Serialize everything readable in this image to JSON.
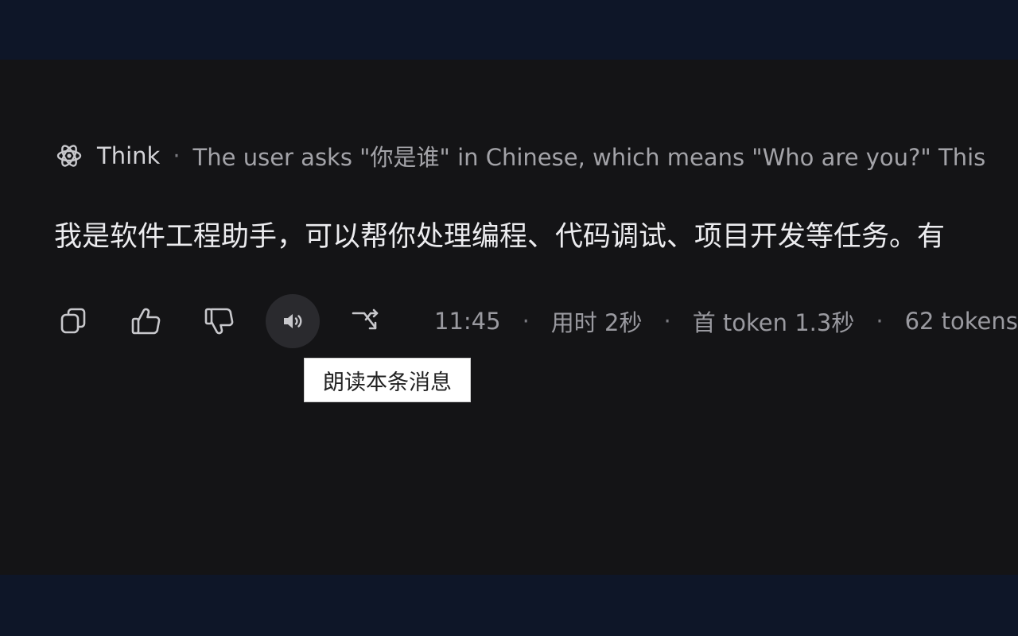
{
  "think": {
    "label": "Think",
    "separator": "·",
    "text": "The user asks \"你是谁\" in Chinese, which means \"Who are you?\" This"
  },
  "message": {
    "text": "我是软件工程助手，可以帮你处理编程、代码调试、项目开发等任务。有"
  },
  "actions": {
    "copy_icon": "copy-icon",
    "like_icon": "thumbs-up-icon",
    "dislike_icon": "thumbs-down-icon",
    "speak_icon": "speaker-icon",
    "branch_icon": "branch-icon"
  },
  "meta": {
    "time": "11:45",
    "duration": "用时 2秒",
    "first_token": "首 token 1.3秒",
    "tokens": "62 tokens",
    "separator": "·"
  },
  "tooltip": {
    "text": "朗读本条消息"
  },
  "colors": {
    "outer_background": "#0e1628",
    "panel_background": "#141416",
    "text_primary": "#ececef",
    "text_secondary": "#a3a3a8"
  }
}
